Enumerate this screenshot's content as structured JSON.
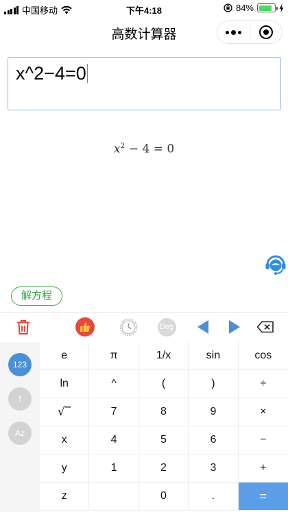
{
  "status": {
    "carrier": "中国移动",
    "time": "下午4:18",
    "battery_percent": "84%",
    "battery_level": 0.84,
    "battery_color": "#4cd964"
  },
  "nav": {
    "title": "高数计算器"
  },
  "input": {
    "expression": "x^2−4=0"
  },
  "rendered": {
    "var": "x",
    "exponent": "2",
    "rest": "− 4 = 0"
  },
  "actions": {
    "solve_label": "解方程"
  },
  "toolbar": {
    "deg_label": "Deg",
    "icons": [
      "trash-icon",
      "thumbs-up-icon",
      "history-clock-icon",
      "deg-icon",
      "arrow-left-icon",
      "arrow-right-icon",
      "backspace-icon"
    ]
  },
  "keyboard": {
    "modes": [
      "123",
      "f",
      "Az"
    ],
    "active_mode": "123",
    "keys": [
      [
        "e",
        "π",
        "1/x",
        "sin",
        "cos"
      ],
      [
        "ln",
        "^",
        "(",
        ")",
        "÷"
      ],
      [
        "√‾",
        "7",
        "8",
        "9",
        "×"
      ],
      [
        "x",
        "4",
        "5",
        "6",
        "−"
      ],
      [
        "y",
        "1",
        "2",
        "3",
        "+"
      ],
      [
        "z",
        "",
        "0",
        ".",
        "="
      ]
    ]
  },
  "colors": {
    "accent": "#4a90d9",
    "solve_green": "#2a9d38",
    "trash_red": "#e0452f",
    "equals_blue": "#5a9ee8"
  }
}
